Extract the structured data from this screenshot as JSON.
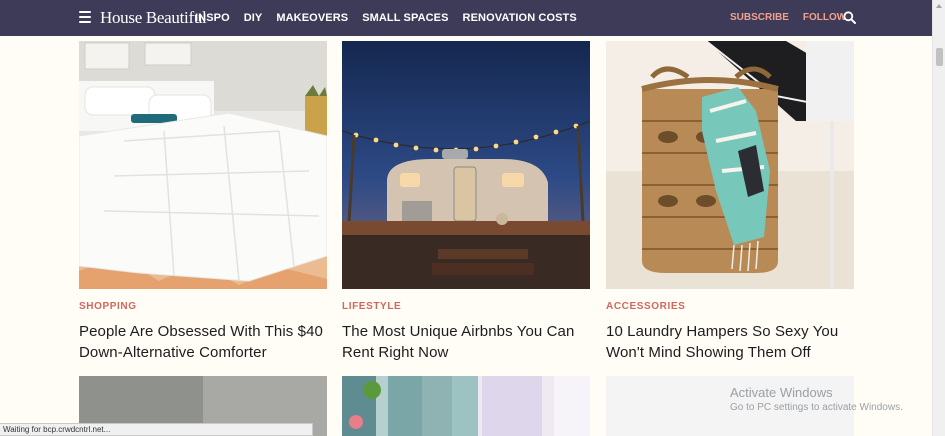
{
  "nav": {
    "logo": "House Beautiful",
    "links": [
      "INSPO",
      "DIY",
      "MAKEOVERS",
      "SMALL SPACES",
      "RENOVATION COSTS"
    ],
    "subscribe": "SUBSCRIBE",
    "follow": "FOLLOW",
    "bg_color": "#3d3b57",
    "accent_color": "#f1a08f"
  },
  "cards": [
    {
      "category": "SHOPPING",
      "title": "People Are Obsessed With This $40 Down-Alternative Comforter"
    },
    {
      "category": "LIFESTYLE",
      "title": "The Most Unique Airbnbs You Can Rent Right Now"
    },
    {
      "category": "ACCESSORIES",
      "title": "10 Laundry Hampers So Sexy You Won't Mind Showing Them Off"
    }
  ],
  "status": "Waiting for bcp.crwdcntrl.net...",
  "watermark": {
    "line1": "Activate Windows",
    "line2": "Go to PC settings to activate Windows."
  }
}
